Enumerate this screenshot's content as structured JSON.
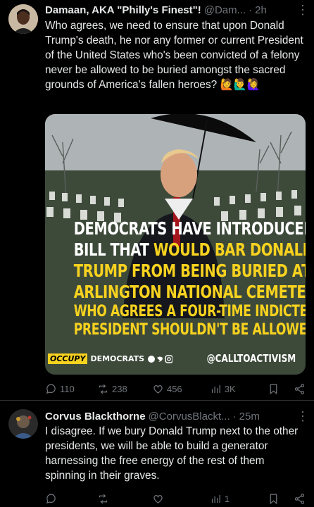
{
  "post1": {
    "name": "Damaan, AKA \"Philly's Finest\"!",
    "handle": "@Dam...",
    "dot": "·",
    "time": "2h",
    "text": "Who agrees, we need to ensure that upon Donald Trump's death, he nor any former or current President of the United States who's been convicted of a felony never be allowed to be buried amongst the sacred grounds of America's fallen heroes? 🙋🙋‍♂️🙋‍♀️",
    "media": {
      "line1": "DEMOCRATS HAVE INTRODUCED A",
      "line2a": "BILL THAT ",
      "line2b": "WOULD BAR DONALD",
      "line3": "TRUMP FROM BEING BURIED AT",
      "line4": "ARLINGTON NATIONAL CEMETERY.",
      "line5": "WHO AGREES A FOUR-TIME INDICTED",
      "line6": "PRESIDENT SHOULDN'T BE ALLOWED?",
      "logo_occupy": "OCCUPY",
      "logo_democrats": "DEMOCRATS",
      "credit": "@CALLTOACTIVISM"
    },
    "replies": "110",
    "reposts": "238",
    "likes": "456",
    "views": "3K"
  },
  "post2": {
    "name": "Corvus Blackthorne",
    "handle": "@CorvusBlackt...",
    "dot": "·",
    "time": "25m",
    "text": "I disagree. If we bury Donald Trump next to the other presidents, we will be able to build a generator harnessing the free energy of the rest of them spinning in their graves.",
    "views": "1"
  },
  "colors": {
    "background": "#000000",
    "text": "#e7e9ea",
    "muted": "#71767b",
    "banner_yellow": "#f7d21f"
  }
}
